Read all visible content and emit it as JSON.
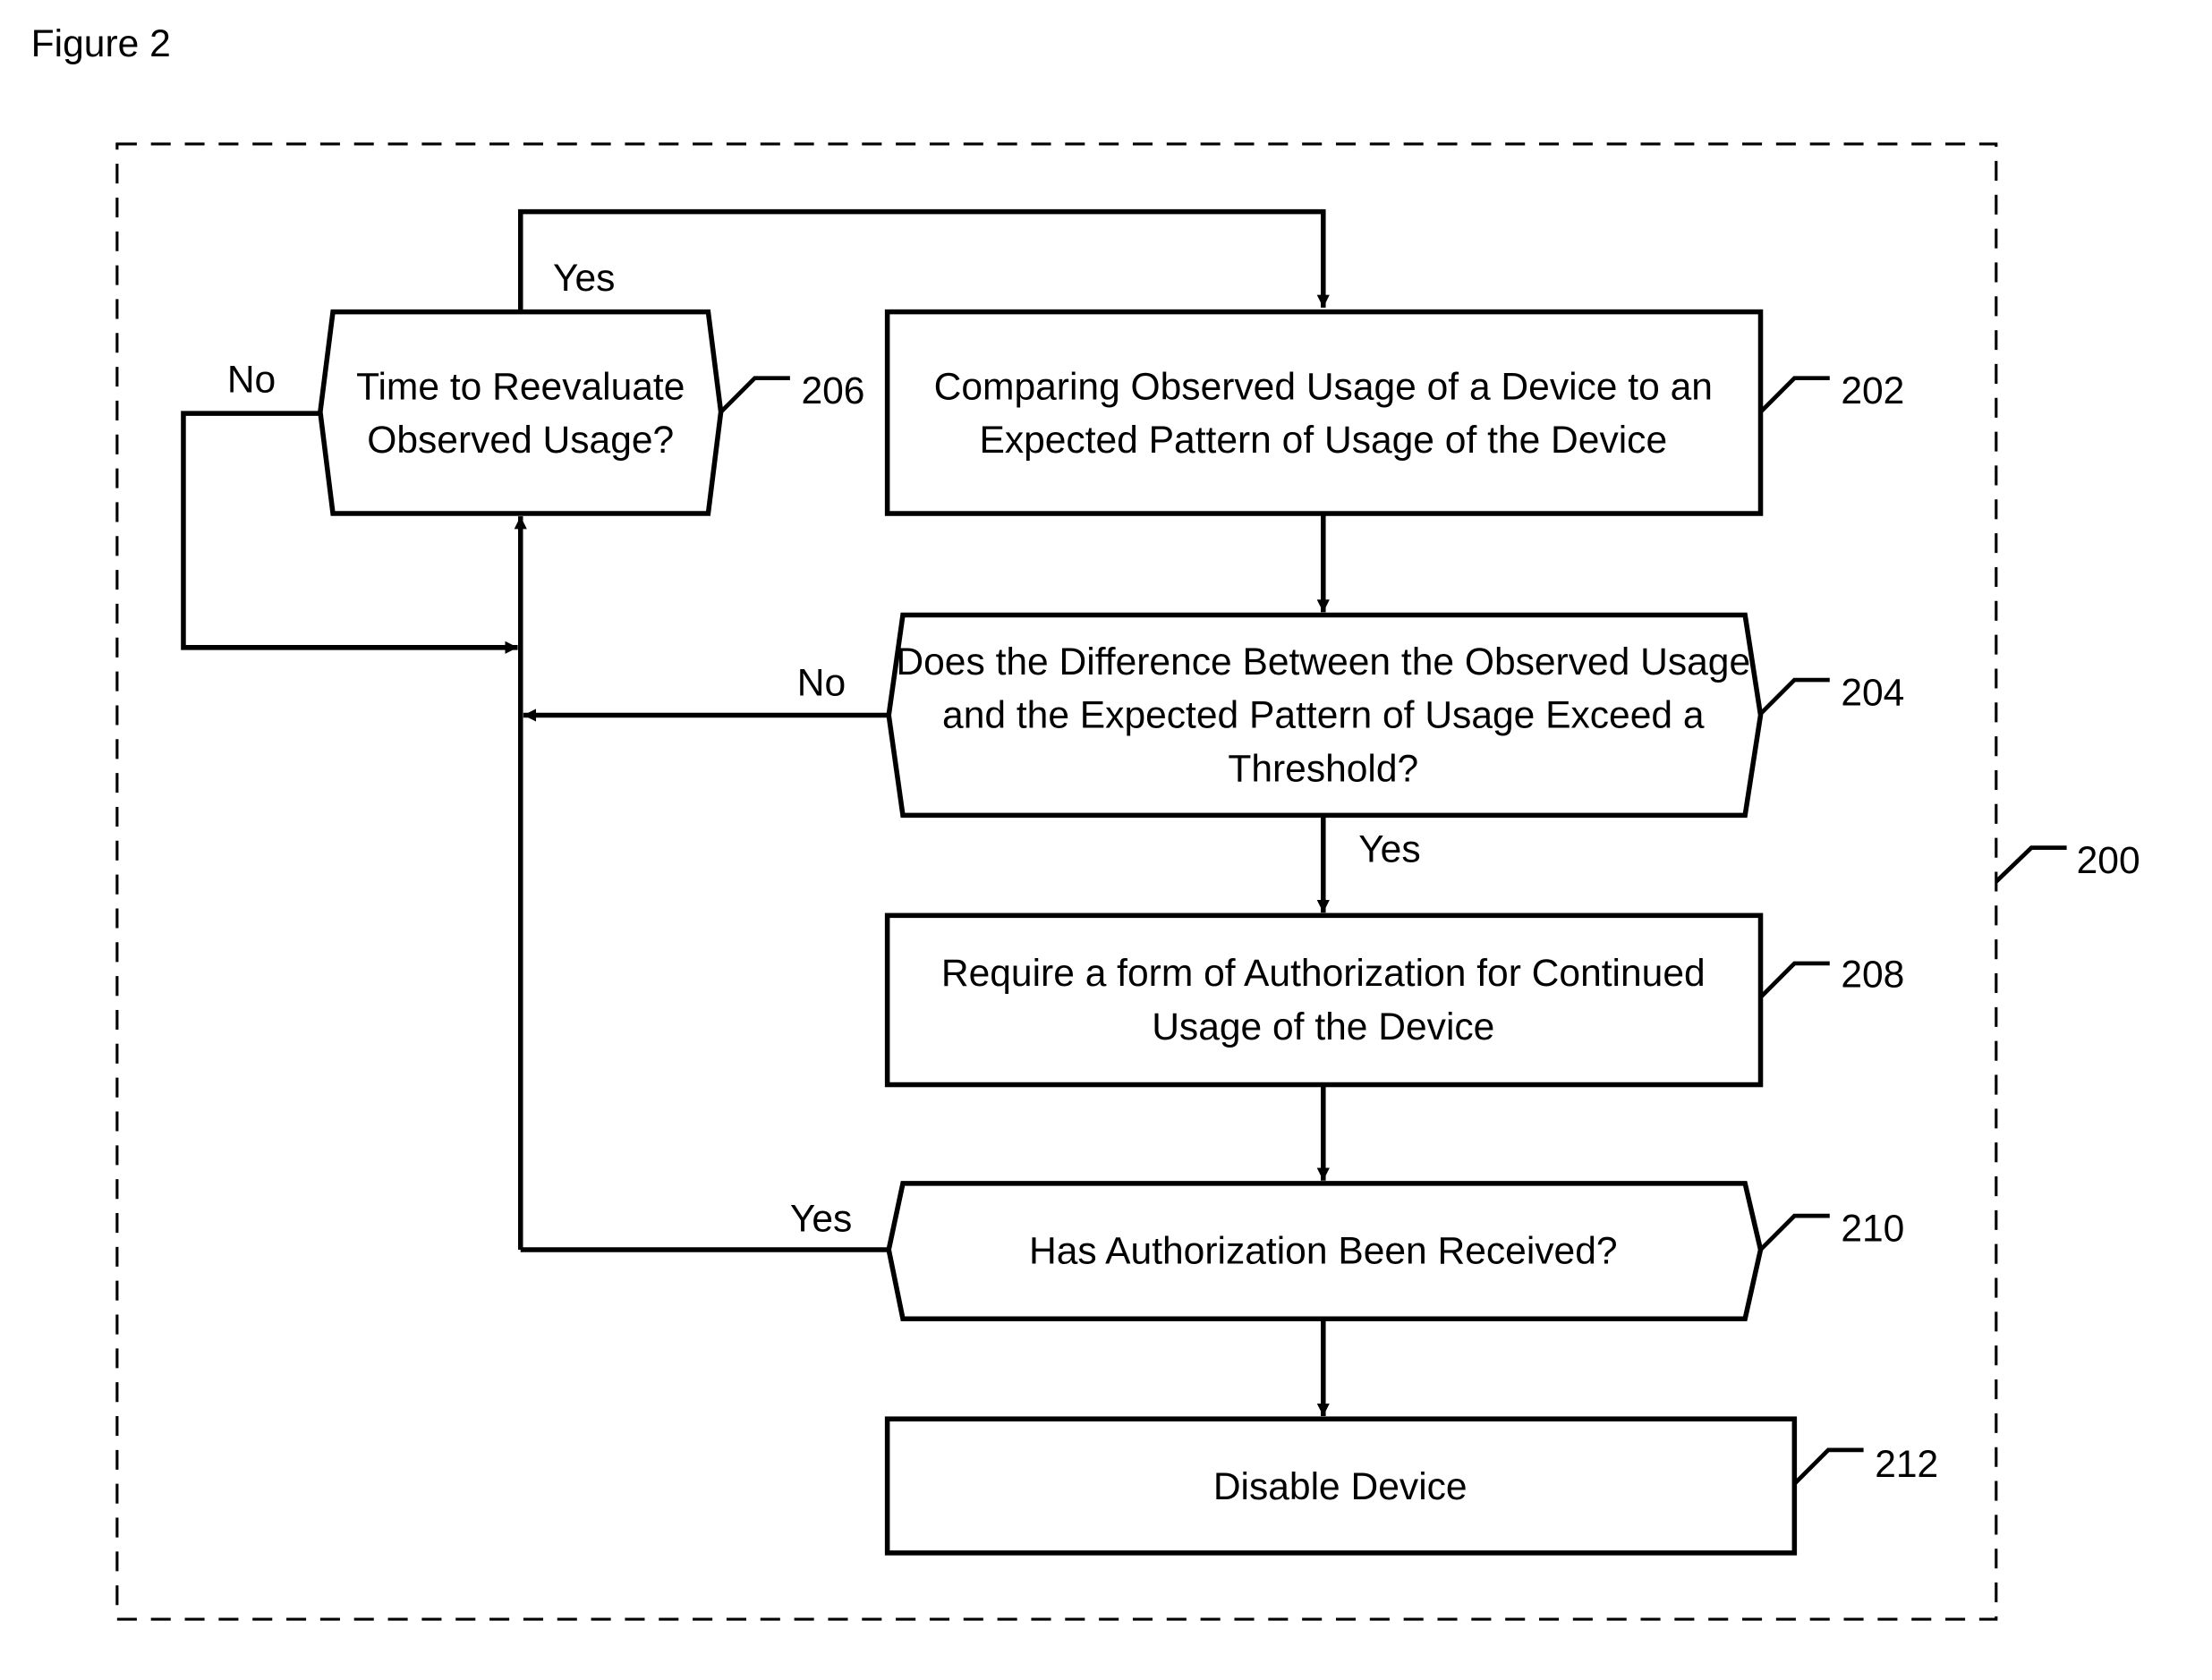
{
  "figure_label": "Figure 2",
  "diagram": {
    "ref": "200",
    "nodes": {
      "n202": {
        "ref": "202",
        "lines": [
          "Comparing Observed Usage of a Device to an",
          "Expected Pattern of Usage of the Device"
        ]
      },
      "n204": {
        "ref": "204",
        "lines": [
          "Does the Difference Between the Observed Usage",
          "and the Expected Pattern of Usage Exceed a",
          "Threshold?"
        ]
      },
      "n206": {
        "ref": "206",
        "lines": [
          "Time to Reevaluate",
          "Observed Usage?"
        ]
      },
      "n208": {
        "ref": "208",
        "lines": [
          "Require a form of Authorization for Continued",
          "Usage of the Device"
        ]
      },
      "n210": {
        "ref": "210",
        "lines": [
          "Has Authorization Been Received?"
        ]
      },
      "n212": {
        "ref": "212",
        "lines": [
          "Disable Device"
        ]
      }
    },
    "edge_labels": {
      "e206_yes": "Yes",
      "e206_no": "No",
      "e204_no": "No",
      "e204_yes": "Yes",
      "e210_yes": "Yes"
    }
  }
}
